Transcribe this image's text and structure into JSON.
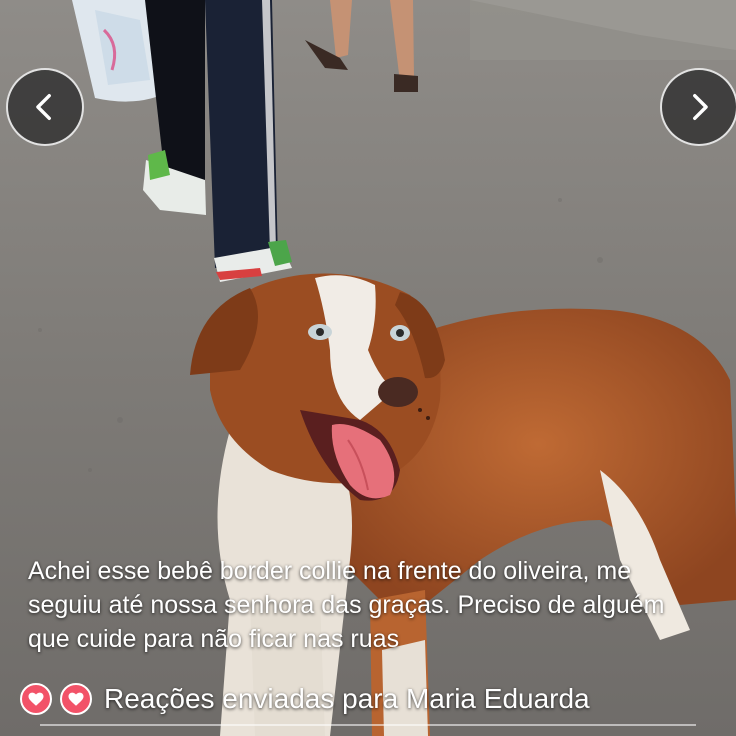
{
  "story": {
    "caption": "Achei esse bebê border collie na frente do oliveira, me seguiu até nossa senhora das graças. Preciso de alguém que cuide para não ficar nas ruas",
    "reactions_text": "Reações enviadas para Maria Eduarda",
    "reaction_icons": [
      "heart-icon",
      "heart-icon"
    ]
  },
  "navigation": {
    "prev_icon": "chevron-left-icon",
    "next_icon": "chevron-right-icon"
  },
  "colors": {
    "reaction_heart": "#f25268",
    "nav_button_bg": "#303030",
    "dog_fur": "#a8582a"
  }
}
